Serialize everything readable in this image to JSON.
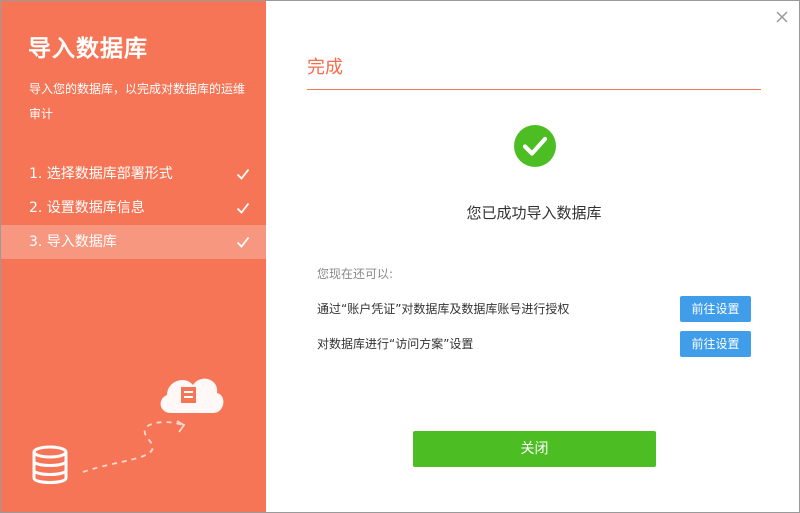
{
  "sidebar": {
    "title": "导入数据库",
    "description": "导入您的数据库，以完成对数据库的运维审计",
    "steps": [
      {
        "label": "1. 选择数据库部署形式",
        "status": "done"
      },
      {
        "label": "2. 设置数据库信息",
        "status": "done"
      },
      {
        "label": "3. 导入数据库",
        "status": "active"
      }
    ]
  },
  "main": {
    "title": "完成",
    "success_message": "您已成功导入数据库",
    "hint": "您现在还可以:",
    "actions": [
      {
        "text": "通过“账户凭证”对数据库及数据库账号进行授权",
        "button": "前往设置"
      },
      {
        "text": "对数据库进行“访问方案”设置",
        "button": "前往设置"
      }
    ],
    "close_button": "关闭"
  },
  "colors": {
    "sidebar_bg": "#f67556",
    "accent": "#f56c4e",
    "success": "#4cbe23",
    "action_button": "#3f9dea"
  }
}
